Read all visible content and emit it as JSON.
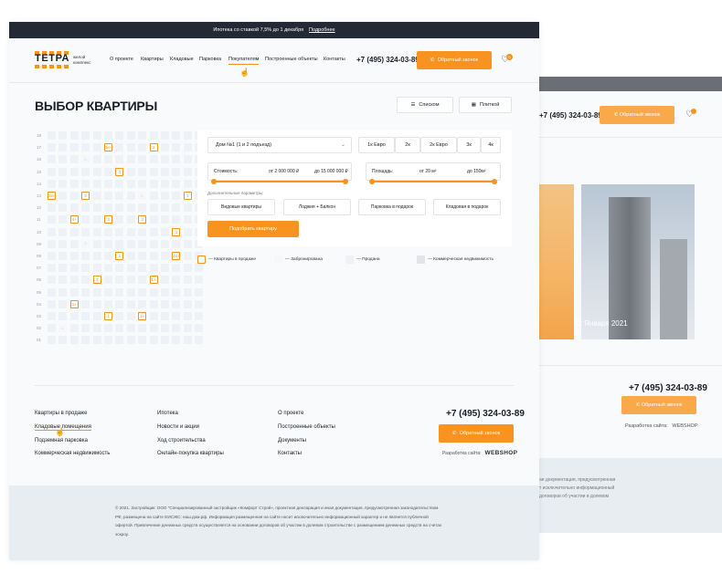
{
  "back": {
    "phone": "+7 (495) 324-03-89",
    "callback_label": "Обратный звонок",
    "news_date": "22 Января 2021",
    "footer_phone": "+7 (495) 324-03-89",
    "footer_callback_label": "Обратный звонок",
    "developer_label": "Разработка сайта:",
    "developer_name": "WEBSHOP",
    "copyright_fragment": "ая документация, предусмотренная\nт исключительно информационный\nдоговоров об участии в долевом"
  },
  "promo": {
    "text": "Ипотека со ставкой 7,5% до 1 декабря",
    "link": "Подробнее"
  },
  "header": {
    "logo": "ТЕТРА",
    "logo_sub": "жилой комплекс",
    "nav": [
      "О проекте",
      "Квартиры",
      "Кладовые",
      "Парковка",
      "Покупателям",
      "Построенные объекты",
      "Контакты"
    ],
    "active_nav": "Покупателям",
    "phone": "+7 (495) 324-03-89",
    "callback_label": "Обратный звонок",
    "favorites_count": "0"
  },
  "page": {
    "title": "ВЫБОР КВАРТИРЫ",
    "view_list": "Списком",
    "view_plan": "Плиткой"
  },
  "chess": {
    "floors": [
      "18",
      "17",
      "16",
      "15",
      "14",
      "13",
      "12",
      "11",
      "10",
      "09",
      "08",
      "07",
      "06",
      "05",
      "04",
      "03",
      "02",
      "01"
    ],
    "labels": [
      {
        "floor": "17",
        "col": 5,
        "text": "1к+"
      },
      {
        "floor": "17",
        "col": 9,
        "text": "2"
      },
      {
        "floor": "15",
        "col": 6,
        "text": "3"
      },
      {
        "floor": "13",
        "col": 0,
        "text": "2к+"
      },
      {
        "floor": "13",
        "col": 3,
        "text": "2"
      },
      {
        "floor": "13",
        "col": 12,
        "text": "1"
      },
      {
        "floor": "11",
        "col": 2,
        "text": "4+"
      },
      {
        "floor": "11",
        "col": 5,
        "text": "3"
      },
      {
        "floor": "11",
        "col": 8,
        "text": "2"
      },
      {
        "floor": "10",
        "col": 11,
        "text": "3"
      },
      {
        "floor": "08",
        "col": 6,
        "text": "1"
      },
      {
        "floor": "08",
        "col": 11,
        "text": "2к+"
      },
      {
        "floor": "06",
        "col": 4,
        "text": "2"
      },
      {
        "floor": "06",
        "col": 9,
        "text": "1+"
      },
      {
        "floor": "04",
        "col": 2,
        "text": "1+"
      },
      {
        "floor": "03",
        "col": 5,
        "text": "1"
      },
      {
        "floor": "03",
        "col": 8,
        "text": "1+"
      }
    ],
    "holds": [
      {
        "floor": "16",
        "col": 3
      },
      {
        "floor": "13",
        "col": 8
      },
      {
        "floor": "09",
        "col": 3
      },
      {
        "floor": "02",
        "col": 1
      }
    ]
  },
  "filter": {
    "house": "Дом №1 (1 и 2 подъезд)",
    "rooms": [
      "1к Евро",
      "2к",
      "2к Евро",
      "3к",
      "4к"
    ],
    "price": {
      "label": "Стоимость:",
      "from": "от 2 000 000 ₽",
      "to": "до 15 000 000 ₽"
    },
    "area": {
      "label": "Площадь:",
      "from": "от 20 м²",
      "to": "до 150м²"
    },
    "extra_title": "Дополнительные параметры:",
    "extras": [
      "Видовые квартиры",
      "Лоджия + Балкон",
      "Парковка в подарок",
      "Кладовая в подарок"
    ],
    "submit": "Подобрать квартиру"
  },
  "legend": [
    {
      "label": "— Квартиры в продаже",
      "color": "#ffffff",
      "border": "#f7931e"
    },
    {
      "label": "— Забронирована",
      "color": "#f6f7f9",
      "border": "#f6f7f9"
    },
    {
      "label": "— Продана",
      "color": "#eef1f5",
      "border": "#eef1f5"
    },
    {
      "label": "— Коммерческая недвижимость",
      "color": "#e1e5ea",
      "border": "#e1e5ea"
    }
  ],
  "footer": {
    "col1": [
      "Квартиры в продаже",
      "Кладовые помещения",
      "Подземная парковка",
      "Коммерческая недвижимость"
    ],
    "col2": [
      "Ипотека",
      "Новости и акции",
      "Ход строительства",
      "Онлайн-покупка квартиры"
    ],
    "col3": [
      "О проекте",
      "Построенные объекты",
      "Документы",
      "Контакты"
    ],
    "phone": "+7 (495) 324-03-89",
    "callback_label": "Обратный звонок",
    "developer_label": "Разработка сайта:",
    "developer_name": "WEBSHOP",
    "copyright": "© 2021. Застройщик: ООО \"Специализированный застройщик «Комфорт Строй», проектная декларация и иная документация, предусмотренная законодательством РФ, размещена на сайте ЕИСЖС: наш.дом.рф. Информация размещенная на сайте носит исключительно информационный характер и не является публичной офертой. Привлечение денежных средств осуществляется на основании договоров об участии в долевом строительстве с размещением денежных средств на счетах эскроу."
  },
  "colors": {
    "accent": "#f7931e",
    "dark": "#232a36",
    "bg": "#f8fafc"
  }
}
